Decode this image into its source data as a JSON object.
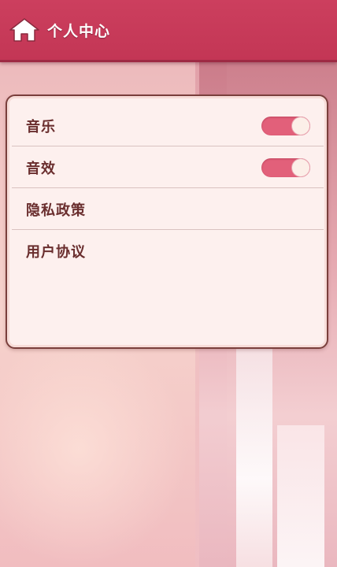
{
  "header": {
    "title": "个人中心",
    "home_icon": "home-icon"
  },
  "settings": {
    "items": [
      {
        "label": "音乐",
        "type": "toggle",
        "value": true
      },
      {
        "label": "音效",
        "type": "toggle",
        "value": true
      },
      {
        "label": "隐私政策",
        "type": "link"
      },
      {
        "label": "用户协议",
        "type": "link"
      }
    ]
  },
  "colors": {
    "header_bg": "#c83a5a",
    "toggle_on": "#e2607a",
    "panel_bg": "#fdf0ee",
    "panel_border": "#7a3f3c",
    "label_text": "#6a2e2e"
  }
}
